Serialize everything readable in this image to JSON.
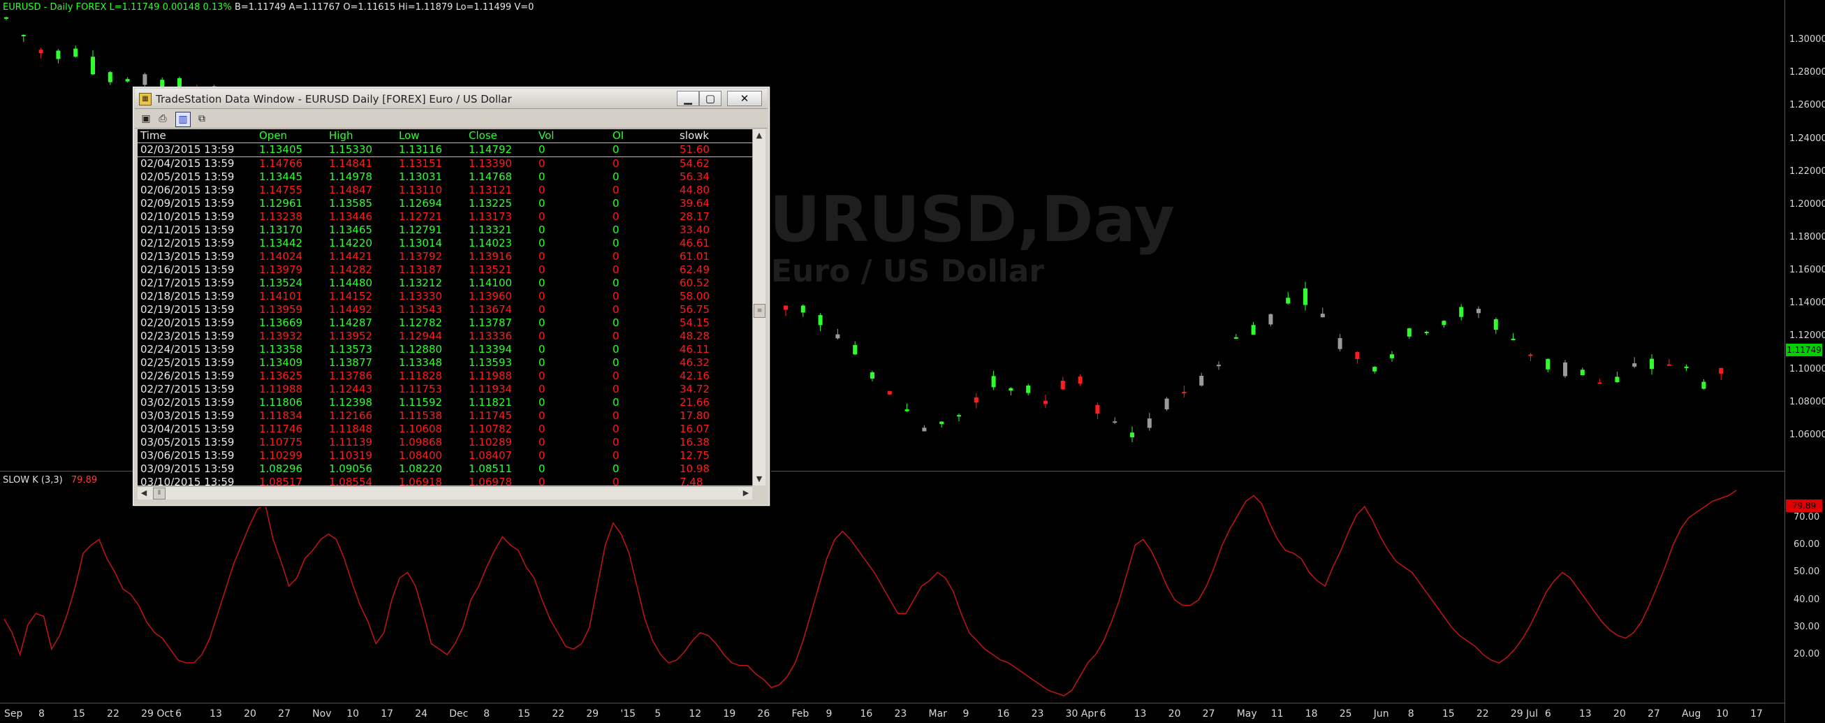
{
  "symbol_bar": {
    "symbol": "EURUSD - Daily  FOREX",
    "last": "L=1.11749",
    "change": "0.00148",
    "pct": "0.13%",
    "bid": "B=1.11749",
    "ask": "A=1.11767",
    "open": "O=1.11615",
    "high": "Hi=1.11879",
    "low": "Lo=1.11499",
    "volume": "V=0"
  },
  "watermark": {
    "symbol": "EURUSD,Day",
    "description": "Euro / US Dollar"
  },
  "indicator": {
    "name": "SLOW K",
    "params": "(3,3)",
    "value": "79.89"
  },
  "price_axis": [
    "1.30000",
    "1.28000",
    "1.26000",
    "1.24000",
    "1.22000",
    "1.20000",
    "1.18000",
    "1.16000",
    "1.14000",
    "1.12000",
    "1.10000",
    "1.08000",
    "1.06000"
  ],
  "price_tag": "1.11749",
  "ind_axis": [
    "70.00",
    "60.00",
    "50.00",
    "40.00",
    "30.00",
    "20.00"
  ],
  "ind_tag": "79.89",
  "date_axis": [
    "Sep",
    "8",
    "15",
    "22",
    "29 Oct",
    "6",
    "13",
    "20",
    "27",
    "Nov",
    "10",
    "17",
    "24",
    "Dec",
    "8",
    "15",
    "22",
    "29",
    "'15",
    "5",
    "12",
    "19",
    "26",
    "Feb",
    "9",
    "16",
    "23",
    "Mar",
    "9",
    "16",
    "23",
    "30 Apr",
    "6",
    "13",
    "20",
    "27",
    "May",
    "11",
    "18",
    "25",
    "Jun",
    "8",
    "15",
    "22",
    "29 Jul",
    "6",
    "13",
    "20",
    "27",
    "Aug",
    "10",
    "17"
  ],
  "data_window": {
    "title": "TradeStation Data Window - EURUSD Daily [FOREX] Euro / US Dollar",
    "buttons": {
      "minimize": "▁",
      "maximize": "▢",
      "close": "✕"
    },
    "toolbar_icons": [
      "save-icon",
      "print-icon",
      "grid-icon",
      "export-icon"
    ],
    "columns": [
      "Time",
      "Open",
      "High",
      "Low",
      "Close",
      "Vol",
      "OI",
      "slowk"
    ],
    "rows": [
      {
        "time": "02/03/2015 13:59",
        "open": "1.13405",
        "high": "1.15330",
        "low": "1.13116",
        "close": "1.14792",
        "vol": "0",
        "oi": "0",
        "k": "51.60",
        "dir": "up"
      },
      {
        "time": "02/04/2015 13:59",
        "open": "1.14766",
        "high": "1.14841",
        "low": "1.13151",
        "close": "1.13390",
        "vol": "0",
        "oi": "0",
        "k": "54.62",
        "dir": "dn"
      },
      {
        "time": "02/05/2015 13:59",
        "open": "1.13445",
        "high": "1.14978",
        "low": "1.13031",
        "close": "1.14768",
        "vol": "0",
        "oi": "0",
        "k": "56.34",
        "dir": "up"
      },
      {
        "time": "02/06/2015 13:59",
        "open": "1.14755",
        "high": "1.14847",
        "low": "1.13110",
        "close": "1.13121",
        "vol": "0",
        "oi": "0",
        "k": "44.80",
        "dir": "dn"
      },
      {
        "time": "02/09/2015 13:59",
        "open": "1.12961",
        "high": "1.13585",
        "low": "1.12694",
        "close": "1.13225",
        "vol": "0",
        "oi": "0",
        "k": "39.64",
        "dir": "up"
      },
      {
        "time": "02/10/2015 13:59",
        "open": "1.13238",
        "high": "1.13446",
        "low": "1.12721",
        "close": "1.13173",
        "vol": "0",
        "oi": "0",
        "k": "28.17",
        "dir": "dn"
      },
      {
        "time": "02/11/2015 13:59",
        "open": "1.13170",
        "high": "1.13465",
        "low": "1.12791",
        "close": "1.13321",
        "vol": "0",
        "oi": "0",
        "k": "33.40",
        "dir": "up"
      },
      {
        "time": "02/12/2015 13:59",
        "open": "1.13442",
        "high": "1.14220",
        "low": "1.13014",
        "close": "1.14023",
        "vol": "0",
        "oi": "0",
        "k": "46.61",
        "dir": "up"
      },
      {
        "time": "02/13/2015 13:59",
        "open": "1.14024",
        "high": "1.14421",
        "low": "1.13792",
        "close": "1.13916",
        "vol": "0",
        "oi": "0",
        "k": "61.01",
        "dir": "dn"
      },
      {
        "time": "02/16/2015 13:59",
        "open": "1.13979",
        "high": "1.14282",
        "low": "1.13187",
        "close": "1.13521",
        "vol": "0",
        "oi": "0",
        "k": "62.49",
        "dir": "dn"
      },
      {
        "time": "02/17/2015 13:59",
        "open": "1.13524",
        "high": "1.14480",
        "low": "1.13212",
        "close": "1.14100",
        "vol": "0",
        "oi": "0",
        "k": "60.52",
        "dir": "up"
      },
      {
        "time": "02/18/2015 13:59",
        "open": "1.14101",
        "high": "1.14152",
        "low": "1.13330",
        "close": "1.13960",
        "vol": "0",
        "oi": "0",
        "k": "58.00",
        "dir": "dn"
      },
      {
        "time": "02/19/2015 13:59",
        "open": "1.13959",
        "high": "1.14492",
        "low": "1.13543",
        "close": "1.13674",
        "vol": "0",
        "oi": "0",
        "k": "56.75",
        "dir": "dn"
      },
      {
        "time": "02/20/2015 13:59",
        "open": "1.13669",
        "high": "1.14287",
        "low": "1.12782",
        "close": "1.13787",
        "vol": "0",
        "oi": "0",
        "k": "54.15",
        "dir": "up"
      },
      {
        "time": "02/23/2015 13:59",
        "open": "1.13932",
        "high": "1.13952",
        "low": "1.12944",
        "close": "1.13336",
        "vol": "0",
        "oi": "0",
        "k": "48.28",
        "dir": "dn"
      },
      {
        "time": "02/24/2015 13:59",
        "open": "1.13358",
        "high": "1.13573",
        "low": "1.12880",
        "close": "1.13394",
        "vol": "0",
        "oi": "0",
        "k": "46.11",
        "dir": "up"
      },
      {
        "time": "02/25/2015 13:59",
        "open": "1.13409",
        "high": "1.13877",
        "low": "1.13348",
        "close": "1.13593",
        "vol": "0",
        "oi": "0",
        "k": "46.32",
        "dir": "up"
      },
      {
        "time": "02/26/2015 13:59",
        "open": "1.13625",
        "high": "1.13786",
        "low": "1.11828",
        "close": "1.11988",
        "vol": "0",
        "oi": "0",
        "k": "42.16",
        "dir": "dn"
      },
      {
        "time": "02/27/2015 13:59",
        "open": "1.11988",
        "high": "1.12443",
        "low": "1.11753",
        "close": "1.11934",
        "vol": "0",
        "oi": "0",
        "k": "34.72",
        "dir": "dn"
      },
      {
        "time": "03/02/2015 13:59",
        "open": "1.11806",
        "high": "1.12398",
        "low": "1.11592",
        "close": "1.11821",
        "vol": "0",
        "oi": "0",
        "k": "21.66",
        "dir": "up"
      },
      {
        "time": "03/03/2015 13:59",
        "open": "1.11834",
        "high": "1.12166",
        "low": "1.11538",
        "close": "1.11745",
        "vol": "0",
        "oi": "0",
        "k": "17.80",
        "dir": "dn"
      },
      {
        "time": "03/04/2015 13:59",
        "open": "1.11746",
        "high": "1.11848",
        "low": "1.10608",
        "close": "1.10782",
        "vol": "0",
        "oi": "0",
        "k": "16.07",
        "dir": "dn"
      },
      {
        "time": "03/05/2015 13:59",
        "open": "1.10775",
        "high": "1.11139",
        "low": "1.09868",
        "close": "1.10289",
        "vol": "0",
        "oi": "0",
        "k": "16.38",
        "dir": "dn"
      },
      {
        "time": "03/06/2015 13:59",
        "open": "1.10299",
        "high": "1.10319",
        "low": "1.08400",
        "close": "1.08407",
        "vol": "0",
        "oi": "0",
        "k": "12.75",
        "dir": "dn"
      },
      {
        "time": "03/09/2015 13:59",
        "open": "1.08296",
        "high": "1.09056",
        "low": "1.08220",
        "close": "1.08511",
        "vol": "0",
        "oi": "0",
        "k": "10.98",
        "dir": "up"
      },
      {
        "time": "03/10/2015 13:59",
        "open": "1.08517",
        "high": "1.08554",
        "low": "1.06918",
        "close": "1.06978",
        "vol": "0",
        "oi": "0",
        "k": "7.48",
        "dir": "dn"
      }
    ]
  },
  "colors": {
    "up": "#2dff2d",
    "down": "#ff1c1c",
    "indicator_line": "#c41414",
    "background": "#000000"
  },
  "chart_data": [
    {
      "type": "candlestick",
      "title": "EURUSD,Day",
      "subtitle": "Euro / US Dollar",
      "ylim": [
        1.04,
        1.32
      ],
      "last": 1.11749
    },
    {
      "type": "line",
      "title": "SLOW K (3,3)",
      "ylim": [
        5,
        84
      ],
      "series": [
        {
          "values": [
            33,
            28,
            20,
            31,
            35,
            34,
            22,
            27,
            35,
            45,
            57,
            60,
            62,
            55,
            50,
            44,
            42,
            38,
            32,
            28,
            26,
            22,
            18,
            17,
            17,
            20,
            26,
            35,
            44,
            53,
            60,
            67,
            73,
            75,
            62,
            54,
            45,
            48,
            55,
            58,
            62,
            64,
            62,
            55,
            46,
            38,
            32,
            24,
            28,
            40,
            48,
            50,
            45,
            35,
            24,
            22,
            20,
            24,
            30,
            40,
            45,
            52,
            58,
            63,
            60,
            58,
            52,
            48,
            40,
            33,
            28,
            23,
            22,
            24,
            30,
            45,
            60,
            68,
            64,
            57,
            45,
            33,
            25,
            20,
            17,
            18,
            21,
            25,
            28,
            27,
            24,
            20,
            17,
            16,
            16,
            13,
            11,
            8,
            9,
            12,
            17,
            25,
            35,
            45,
            55,
            62,
            65,
            62,
            58,
            54,
            50,
            45,
            40,
            35,
            35,
            40,
            45,
            47,
            50,
            48,
            43,
            35,
            28,
            25,
            22,
            20,
            18,
            17,
            15,
            13,
            11,
            9,
            7,
            6,
            5,
            7,
            12,
            17,
            20,
            25,
            32,
            40,
            50,
            60,
            62,
            58,
            52,
            45,
            40,
            38,
            38,
            40,
            45,
            52,
            60,
            66,
            71,
            76,
            78,
            75,
            68,
            62,
            58,
            57,
            55,
            50,
            47,
            45,
            52,
            58,
            65,
            71,
            74,
            69,
            63,
            58,
            54,
            52,
            50,
            46,
            42,
            38,
            34,
            30,
            27,
            25,
            23,
            20,
            18,
            17,
            19,
            22,
            26,
            31,
            37,
            43,
            47,
            50,
            48,
            44,
            40,
            36,
            32,
            29,
            27,
            26,
            28,
            32,
            38,
            45,
            52,
            60,
            66,
            70,
            72,
            74,
            76,
            77,
            78,
            79.89
          ]
        }
      ]
    }
  ]
}
